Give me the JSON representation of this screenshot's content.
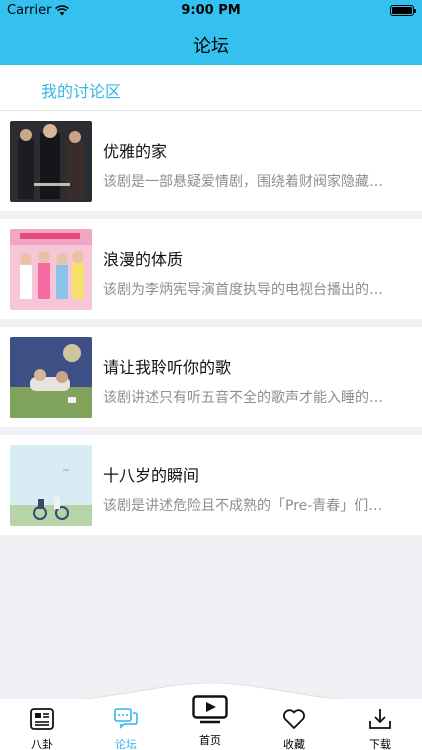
{
  "status": {
    "carrier": "Carrier",
    "time": "9:00 PM"
  },
  "nav": {
    "title": "论坛"
  },
  "section": {
    "title": "我的讨论区"
  },
  "posts": [
    {
      "title": "优雅的家",
      "desc": "该剧是一部悬疑爱情剧，围绕着财阀家隐藏…",
      "thumb_color": "#2b2d33"
    },
    {
      "title": "浪漫的体质",
      "desc": "该剧为李炳宪导演首度执导的电视台播出的…",
      "thumb_color": "#f0a7c4"
    },
    {
      "title": "请让我聆听你的歌",
      "desc": "该剧讲述只有听五音不全的歌声才能入睡的…",
      "thumb_color": "#5a6fa3"
    },
    {
      "title": "十八岁的瞬间",
      "desc": "该剧是讲述危险且不成熟的「Pre-青春」们…",
      "thumb_color": "#cfe6ef"
    }
  ],
  "tabs": [
    {
      "label": "八卦",
      "icon": "news-icon"
    },
    {
      "label": "论坛",
      "icon": "chat-icon"
    },
    {
      "label": "首页",
      "icon": "play-screen-icon"
    },
    {
      "label": "收藏",
      "icon": "heart-icon"
    },
    {
      "label": "下载",
      "icon": "download-icon"
    }
  ],
  "colors": {
    "accent": "#35c1ef",
    "active_tab": "#35b6e6"
  }
}
